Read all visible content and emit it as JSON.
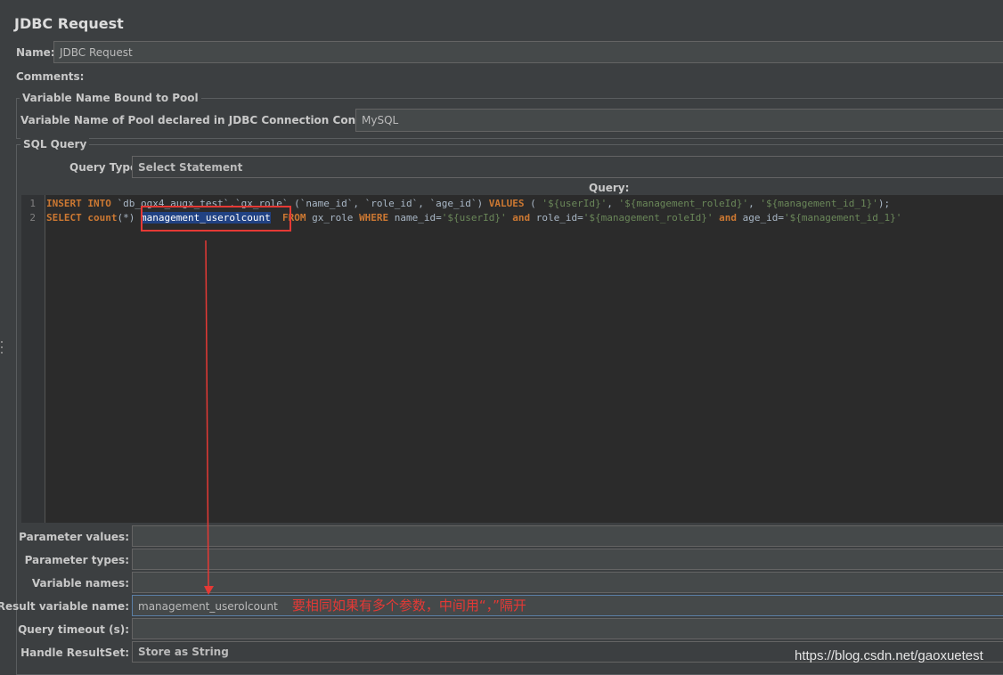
{
  "title": "JDBC Request",
  "name": {
    "label": "Name:",
    "value": "JDBC Request"
  },
  "comments": {
    "label": "Comments:"
  },
  "pool_group": {
    "title": "Variable Name Bound to Pool",
    "label": "Variable Name of Pool declared in JDBC Connection Configuration:",
    "value": "MySQL"
  },
  "sql_group": {
    "title": "SQL Query",
    "query_type": {
      "label": "Query Type:",
      "value": "Select Statement"
    },
    "query_label": "Query:",
    "lines": [
      {
        "num": "1",
        "tokens": [
          {
            "t": "INSERT",
            "c": "kw"
          },
          {
            "t": " ",
            "c": ""
          },
          {
            "t": "INTO",
            "c": "kw"
          },
          {
            "t": " `db_ogx4_augx_test`.`gx_role` (`name_id`, `role_id`, `age_id`) ",
            "c": ""
          },
          {
            "t": "VALUES",
            "c": "kw"
          },
          {
            "t": " ( ",
            "c": ""
          },
          {
            "t": "'${userId}'",
            "c": "str"
          },
          {
            "t": ", ",
            "c": ""
          },
          {
            "t": "'${management_roleId}'",
            "c": "str"
          },
          {
            "t": ", ",
            "c": ""
          },
          {
            "t": "'${management_id_1}'",
            "c": "str"
          },
          {
            "t": ");",
            "c": ""
          }
        ]
      },
      {
        "num": "2",
        "tokens": [
          {
            "t": "SELECT",
            "c": "kw"
          },
          {
            "t": " ",
            "c": ""
          },
          {
            "t": "count",
            "c": "kw"
          },
          {
            "t": "(*) ",
            "c": ""
          },
          {
            "t": "management_userolcount",
            "c": "sel"
          },
          {
            "t": "  ",
            "c": ""
          },
          {
            "t": "FROM",
            "c": "kw"
          },
          {
            "t": " gx_role ",
            "c": ""
          },
          {
            "t": "WHERE",
            "c": "kw"
          },
          {
            "t": " name_id=",
            "c": ""
          },
          {
            "t": "'${userId}'",
            "c": "str"
          },
          {
            "t": " ",
            "c": ""
          },
          {
            "t": "and",
            "c": "kw"
          },
          {
            "t": " role_id=",
            "c": ""
          },
          {
            "t": "'${management_roleId}'",
            "c": "str"
          },
          {
            "t": " ",
            "c": ""
          },
          {
            "t": "and",
            "c": "kw"
          },
          {
            "t": " age_id=",
            "c": ""
          },
          {
            "t": "'${management_id_1}'",
            "c": "str"
          }
        ]
      }
    ]
  },
  "params": [
    {
      "label": "Parameter values:",
      "value": ""
    },
    {
      "label": "Parameter types:",
      "value": ""
    },
    {
      "label": "Variable names:",
      "value": ""
    },
    {
      "label": "Result variable name:",
      "value": "management_userolcount",
      "note": "要相同如果有多个参数，中间用“，”隔开"
    },
    {
      "label": "Query timeout (s):",
      "value": ""
    },
    {
      "label": "Handle ResultSet:",
      "value": "Store as String"
    }
  ],
  "watermark": "https://blog.csdn.net/gaoxuetest",
  "colors": {
    "annotation": "#e53935",
    "selection": "#214283"
  }
}
